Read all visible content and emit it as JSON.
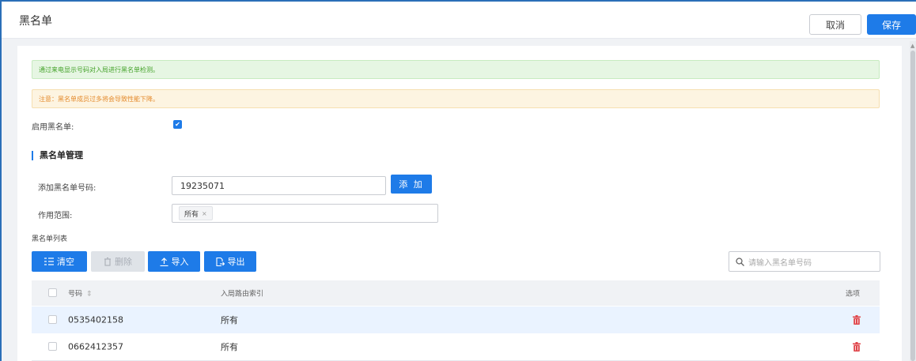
{
  "header": {
    "title": "黑名单",
    "cancel_label": "取消",
    "save_label": "保存"
  },
  "alerts": {
    "info": "通过来电显示号码对入局进行黑名单检测。",
    "warning": "注意：黑名单成员过多将会导致性能下降。"
  },
  "enable": {
    "label": "启用黑名单:",
    "checked": true
  },
  "section": {
    "title": "黑名单管理"
  },
  "add_number": {
    "label": "添加黑名单号码:",
    "value": "19235071",
    "button_label": "添 加"
  },
  "scope": {
    "label": "作用范围:",
    "tag": "所有",
    "tag_remove": "×"
  },
  "list": {
    "title": "黑名单列表"
  },
  "toolbar": {
    "clear_label": "清空",
    "delete_label": "删除",
    "import_label": "导入",
    "export_label": "导出",
    "search_placeholder": "请输入黑名单号码"
  },
  "table": {
    "columns": {
      "number": "号码",
      "sort_icon": "⇕",
      "route": "入局路由索引",
      "options": "选项"
    },
    "rows": [
      {
        "number": "0535402158",
        "route": "所有"
      },
      {
        "number": "0662412357",
        "route": "所有"
      }
    ]
  },
  "colors": {
    "accent": "#1e7be8",
    "danger": "#e0474c",
    "success": "#45a32b",
    "warning": "#e48a2c"
  }
}
